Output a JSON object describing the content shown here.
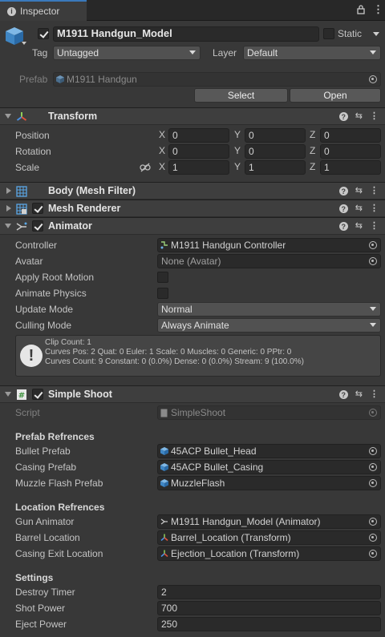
{
  "tab": {
    "title": "Inspector"
  },
  "header": {
    "object_name": "M1911 Handgun_Model",
    "active": true,
    "static_label": "Static",
    "tag_label": "Tag",
    "tag_value": "Untagged",
    "layer_label": "Layer",
    "layer_value": "Default",
    "prefab_label": "Prefab",
    "prefab_value": "M1911 Handgun",
    "select_label": "Select",
    "open_label": "Open"
  },
  "transform": {
    "title": "Transform",
    "rows": [
      {
        "label": "Position",
        "x": "0",
        "y": "0",
        "z": "0"
      },
      {
        "label": "Rotation",
        "x": "0",
        "y": "0",
        "z": "0"
      },
      {
        "label": "Scale",
        "x": "1",
        "y": "1",
        "z": "1"
      }
    ],
    "axes": [
      "X",
      "Y",
      "Z"
    ]
  },
  "mesh_filter": {
    "title": "Body (Mesh Filter)"
  },
  "mesh_renderer": {
    "title": "Mesh Renderer",
    "enabled": true
  },
  "animator": {
    "title": "Animator",
    "enabled": true,
    "controller_label": "Controller",
    "controller_value": "M1911 Handgun Controller",
    "avatar_label": "Avatar",
    "avatar_value": "None (Avatar)",
    "root_motion_label": "Apply Root Motion",
    "physics_label": "Animate Physics",
    "update_label": "Update Mode",
    "update_value": "Normal",
    "culling_label": "Culling Mode",
    "culling_value": "Always Animate",
    "info_line1": "Clip Count: 1",
    "info_line2": "Curves Pos: 2 Quat: 0 Euler: 1 Scale: 0 Muscles: 0 Generic: 0 PPtr: 0",
    "info_line3": "Curves Count: 9 Constant: 0 (0.0%) Dense: 0 (0.0%) Stream: 9 (100.0%)"
  },
  "simple_shoot": {
    "title": "Simple Shoot",
    "enabled": true,
    "script_label": "Script",
    "script_value": "SimpleShoot",
    "prefab_section": "Prefab Refrences",
    "bullet_label": "Bullet Prefab",
    "bullet_value": "45ACP Bullet_Head",
    "casing_label": "Casing Prefab",
    "casing_value": "45ACP Bullet_Casing",
    "muzzle_label": "Muzzle Flash Prefab",
    "muzzle_value": "MuzzleFlash",
    "location_section": "Location Refrences",
    "gun_anim_label": "Gun Animator",
    "gun_anim_value": "M1911 Handgun_Model (Animator)",
    "barrel_label": "Barrel Location",
    "barrel_value": "Barrel_Location (Transform)",
    "casing_exit_label": "Casing Exit Location",
    "casing_exit_value": "Ejection_Location (Transform)",
    "settings_section": "Settings",
    "destroy_label": "Destroy Timer",
    "destroy_value": "2",
    "shot_label": "Shot Power",
    "shot_value": "700",
    "eject_label": "Eject Power",
    "eject_value": "250"
  }
}
